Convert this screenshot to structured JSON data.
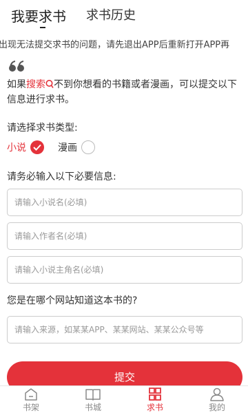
{
  "tabs": {
    "active": "我要求书",
    "history": "求书历史"
  },
  "notice": "出现无法提交求书的问题，请先退出APP后重新打开APP再",
  "description": {
    "prefix": "如果",
    "search_link": "搜索",
    "suffix": "不到你想看的书籍或者漫画，可以提交以下信息进行求书。"
  },
  "type_section": {
    "label": "请选择求书类型:",
    "options": [
      {
        "label": "小说",
        "selected": true
      },
      {
        "label": "漫画",
        "selected": false
      }
    ]
  },
  "required_label": "请务必输入以下必要信息:",
  "inputs": {
    "novel_name_placeholder": "请输入小说名(必填)",
    "author_placeholder": "请输入作者名(必填)",
    "protagonist_placeholder": "请输入小说主角名(必填)"
  },
  "source_section": {
    "label": "您是在哪个网站知道这本书的?",
    "placeholder": "请输入来源，如某某APP、某某网站、某某公众号等"
  },
  "submit_label": "提交",
  "nav": {
    "items": [
      {
        "label": "书架",
        "icon": "bookshelf-icon",
        "active": false
      },
      {
        "label": "书城",
        "icon": "open-book-icon",
        "active": false
      },
      {
        "label": "求书",
        "icon": "grid-icon",
        "active": true
      },
      {
        "label": "我的",
        "icon": "person-icon",
        "active": false
      }
    ]
  },
  "colors": {
    "accent": "#e4323a",
    "text": "#333333",
    "muted": "#999999"
  }
}
